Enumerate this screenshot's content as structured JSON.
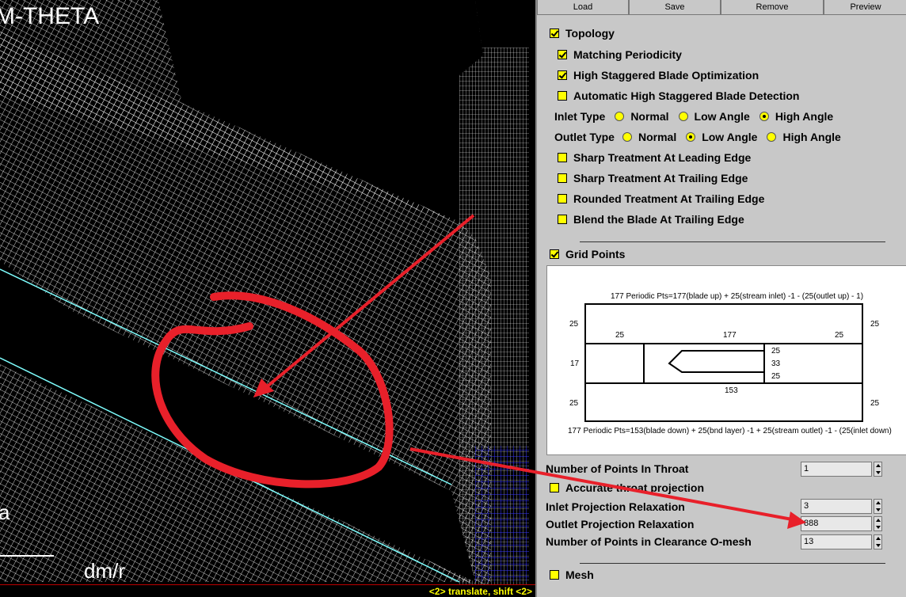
{
  "viewport": {
    "title": "M-THETA",
    "axis_label": "dm/r",
    "left_label": "a",
    "status": "<2> translate, shift <2>"
  },
  "toolbar": {
    "load": "Load",
    "save": "Save",
    "remove": "Remove",
    "preview": "Preview"
  },
  "topology": {
    "label": "Topology",
    "checked": true,
    "options": {
      "matching_periodicity": "Matching Periodicity",
      "high_staggered_opt": "High Staggered Blade Optimization",
      "auto_high_staggered": "Automatic High Staggered Blade Detection"
    },
    "inlet": {
      "label": "Inlet Type",
      "normal": "Normal",
      "low": "Low Angle",
      "high": "High Angle",
      "selected": "High Angle"
    },
    "outlet": {
      "label": "Outlet Type",
      "normal": "Normal",
      "low": "Low Angle",
      "high": "High Angle",
      "selected": "Low Angle"
    },
    "sharp_le": "Sharp Treatment At Leading Edge",
    "sharp_te": "Sharp Treatment At Trailing Edge",
    "rounded_te": "Rounded Treatment At Trailing Edge",
    "blend_te": "Blend the Blade At Trailing Edge"
  },
  "grid_points": {
    "label": "Grid Points",
    "diagram": {
      "top_caption": "177 Periodic Pts=177(blade up) + 25(stream inlet) -1 - (25(outlet up) - 1)",
      "bottom_caption": "177 Periodic Pts=153(blade down) + 25(bnd layer) -1 + 25(stream outlet) -1 - (25(inlet down)",
      "l25a": "25",
      "r25a": "25",
      "top25a": "25",
      "top177": "177",
      "top25b": "25",
      "l17": "17",
      "m25a": "25",
      "m33": "33",
      "m25b": "25",
      "b153": "153",
      "l25b": "25",
      "r25b": "25"
    },
    "throat_label": "Number of Points In Throat",
    "throat_value": "1",
    "accurate_label": "Accurate throat projection",
    "inlet_relax_label": "Inlet Projection Relaxation",
    "inlet_relax_value": "3",
    "outlet_relax_label": "Outlet Projection Relaxation",
    "outlet_relax_value": "888",
    "clearance_label": "Number of Points in Clearance O-mesh",
    "clearance_value": "13"
  },
  "mesh": {
    "label": "Mesh"
  }
}
